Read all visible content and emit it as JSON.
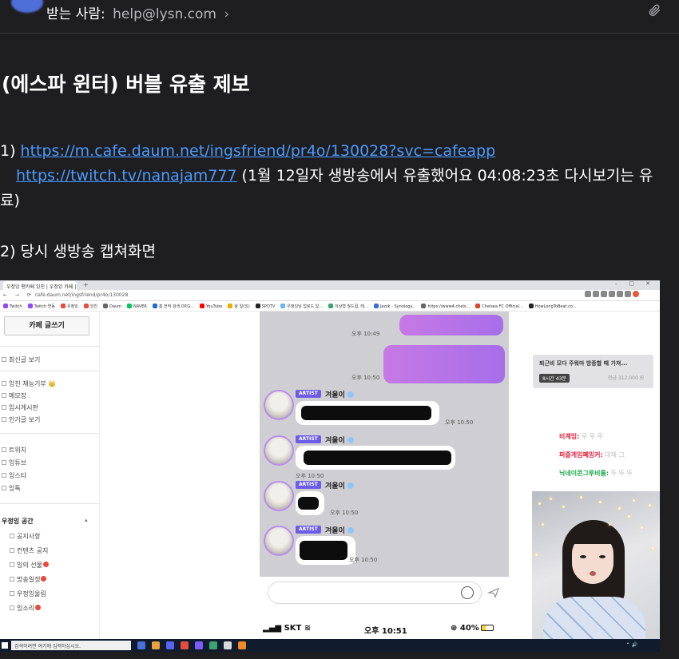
{
  "header": {
    "to_label": "받는 사람:",
    "to_email": "help@lysn.com",
    "chevron": "›",
    "attachment_icon": "paperclip-icon"
  },
  "email": {
    "subject": "(에스파 윈터)  버블 유출 제보",
    "line1_prefix": "1) ",
    "line1_link": "https://m.cafe.daum.net/ingsfriend/pr4o/130028?svc=cafeapp",
    "line2_link": "https://twitch.tv/nanajam777",
    "line2_text": " (1월 12일자 생방송에서 유출했어요 04:08:23초 다시보기는 유",
    "line3_text": "료)",
    "line4_text": "2) 당시 생방송 캡쳐화면"
  },
  "screenshot": {
    "browser": {
      "tab_title": "우정잉 팬카페 잉친 | 우정잉 카페 | 다음 카페",
      "tab_plus": "+",
      "window_controls": "–  ▢  ✕",
      "nav": "←  →  ⟳",
      "url": "cafe.daum.net/ingsfriend/pr4o/130028",
      "bookmarks": [
        "Twitch",
        "Twitch 연동",
        "유정잉",
        "잉친",
        "Daum",
        "NAVER",
        "홈 전적 검색 OP.G...",
        "YouTube",
        "왕 일(잉)",
        "SPOTV",
        "우정잉님 업로드 일...",
        "이상형 월드컵, 테...",
        "Jazzk - Synology...",
        "https://www4.chels...",
        "Chelsea FC Official...",
        "HowLongToBeat.co..."
      ],
      "bookmark_colors": [
        "#9146ff",
        "#9146ff",
        "#e84a3c",
        "#e84a3c",
        "#666666",
        "#03c75a",
        "#1f6bd6",
        "#ff0000",
        "#f2a900",
        "#222222",
        "#6bb3ff",
        "#3aa56f",
        "#3a6fd8",
        "#666666",
        "#d64a2a",
        "#222222"
      ]
    },
    "cafe_sidebar": {
      "write_button": "카페 글쓰기",
      "items": [
        "최신글 보기",
        "잉친 재능기부 👑",
        "메모장",
        "임시게시판",
        "인기글 보기",
        "트위치",
        "잉튜브",
        "잉스타",
        "잉톡"
      ],
      "section": "우정잉 공간",
      "section_chevron": "▴",
      "section_items": [
        "공지사항",
        "컨텐츠 공지",
        "잉의 선물",
        "방송일정",
        "우정잉울림",
        "잉소리"
      ]
    },
    "chat": {
      "time1": "오후 10:49",
      "time2": "오후 10:50",
      "artist_badge": "ARTIST",
      "artist_name": "겨울이",
      "msg_times": [
        "오후 10:50",
        "오후 10:50",
        "오후 10:50",
        "오후 10:50"
      ]
    },
    "status_bar": {
      "carrier": "SKT",
      "time": "오후 10:51",
      "battery": "40%",
      "carrier_signal": "▂▄▆",
      "wifi": "≋",
      "battery_prefix": "⊕"
    },
    "donation": {
      "title": "퇴근비 모다 주워마 방종할 때 가져...",
      "badge": "8시간 43분",
      "amount": "현금 312,000 원"
    },
    "stream_chat": [
      {
        "name": "비계잉:",
        "text": " 뚜 뚜 뚜",
        "color": "#e5213b"
      },
      {
        "name": "퍼즐게임폐잉커:",
        "text": " 대체 그",
        "color": "#e5213b"
      },
      {
        "name": "닉네이콘그루비룸:",
        "text": " 뚜 뚜 뚜",
        "color": "#1aa84a"
      }
    ],
    "taskbar": {
      "search_placeholder": "검색하려면 여기에 입력하십시오.",
      "tray": "⌃ 🔊"
    }
  }
}
